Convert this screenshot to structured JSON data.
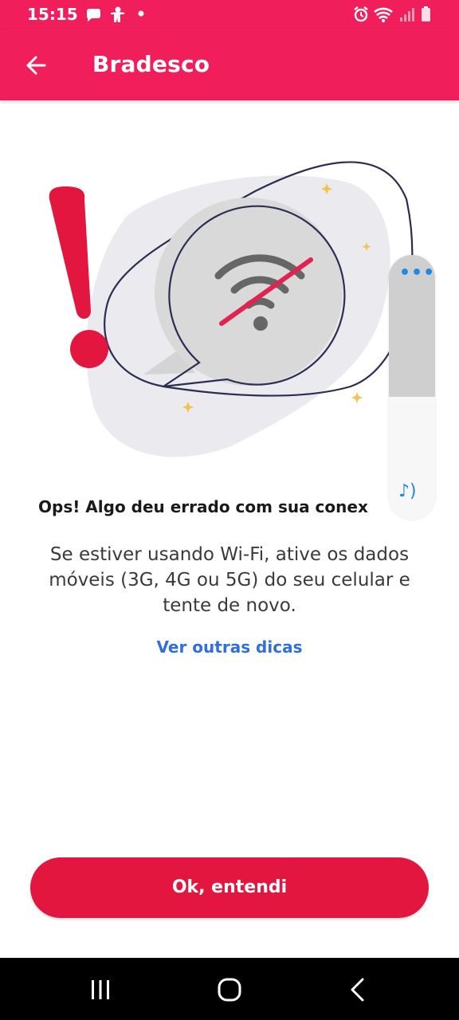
{
  "status_bar": {
    "time": "15:15",
    "left_icons": [
      "chat-bubble-icon",
      "person-icon",
      "dot-icon"
    ],
    "right_icons": [
      "alarm-icon",
      "wifi-icon",
      "signal-icon",
      "battery-icon"
    ]
  },
  "app_bar": {
    "title": "Bradesco",
    "back_icon": "arrow-left-icon",
    "color": "#f01f5c"
  },
  "illustration": {
    "icons": [
      "exclamation-icon",
      "wifi-off-icon",
      "speech-bubble-icon"
    ]
  },
  "floating_widget": {
    "icons": [
      "more-dots-icon",
      "sound-icon"
    ]
  },
  "error": {
    "title": "Ops! Algo deu errado com sua conex",
    "message": "Se estiver usando Wi-Fi, ative os dados móveis (3G, 4G ou 5G) do seu celular e tente de novo."
  },
  "tips_link": {
    "label": "Ver outras dicas",
    "color": "#2f6fe0"
  },
  "primary_button": {
    "label": "Ok, entendi",
    "color": "#e3163f"
  },
  "nav_bar": {
    "buttons": [
      "recent-apps-icon",
      "home-icon",
      "back-icon"
    ]
  }
}
